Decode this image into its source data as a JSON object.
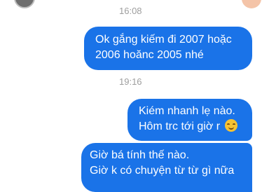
{
  "conversation": {
    "timestamps": [
      "16:08",
      "19:16"
    ],
    "messages": [
      {
        "lines": [
          "Ok gắng kiếm đi 2007 hoặc",
          "2006 hoănc 2005 nhé"
        ]
      },
      {
        "lines": [
          "Kiém nhanh lẹ nào.",
          "Hôm trc tới giờ r"
        ],
        "emoji": "smiling-face-emoji"
      },
      {
        "lines": [
          "Giờ bá tính thế nào.",
          "Giờ k có chuyện từ từ gì nữa"
        ]
      }
    ]
  },
  "colors": {
    "sent_bubble": "#1a73e8",
    "timestamp_text": "#9e9e9e"
  }
}
